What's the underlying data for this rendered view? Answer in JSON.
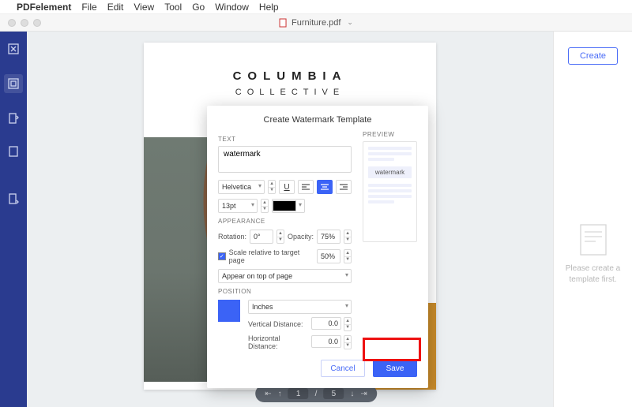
{
  "menubar": {
    "app": "PDFelement",
    "items": [
      "File",
      "Edit",
      "View",
      "Tool",
      "Go",
      "Window",
      "Help"
    ]
  },
  "window": {
    "doc_title": "Furniture.pdf"
  },
  "rightpanel": {
    "create": "Create",
    "placeholder_l1": "Please create a",
    "placeholder_l2": "template first."
  },
  "document": {
    "heading": "COLUMBIA",
    "subheading": "COLLECTIVE"
  },
  "pagenav": {
    "current": "1",
    "sep": "/",
    "total": "5"
  },
  "modal": {
    "title": "Create Watermark Template",
    "sections": {
      "text": "TEXT",
      "appearance": "APPEARANCE",
      "position": "POSITION",
      "preview": "PREVIEW"
    },
    "text_value": "watermark",
    "font": "Helvetica",
    "size": "13pt",
    "underline": "U",
    "rotation_label": "Rotation:",
    "rotation_value": "0°",
    "opacity_label": "Opacity:",
    "opacity_value": "75%",
    "scale_label": "Scale relative to target page",
    "scale_value": "50%",
    "appear_select": "Appear on top of page",
    "unit": "Inches",
    "vdist_label": "Vertical Distance:",
    "vdist_value": "0.0",
    "hdist_label": "Horizontal Distance:",
    "hdist_value": "0.0",
    "preview_text": "watermark",
    "cancel": "Cancel",
    "save": "Save"
  }
}
